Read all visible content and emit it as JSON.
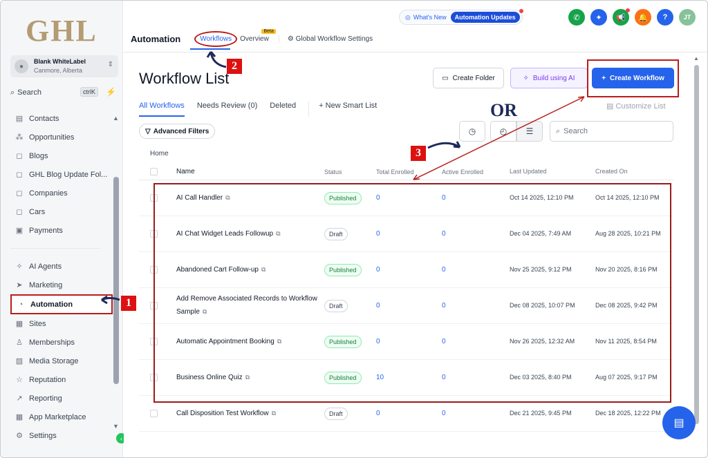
{
  "sidebar": {
    "logo": "GHL",
    "account": {
      "name": "Blank WhiteLabel",
      "location": "Canmore, Alberta"
    },
    "search": {
      "label": "Search",
      "shortcut": "ctrlK"
    },
    "items": [
      {
        "label": "Contacts",
        "icon": "contacts-icon",
        "glyph": "▤"
      },
      {
        "label": "Opportunities",
        "icon": "opportunities-icon",
        "glyph": "⁂"
      },
      {
        "label": "Blogs",
        "icon": "blogs-icon",
        "glyph": "◻"
      },
      {
        "label": "GHL Blog Update Fol...",
        "icon": "folder-icon",
        "glyph": "◻"
      },
      {
        "label": "Companies",
        "icon": "companies-icon",
        "glyph": "◻"
      },
      {
        "label": "Cars",
        "icon": "cars-icon",
        "glyph": "◻"
      },
      {
        "label": "Payments",
        "icon": "payments-icon",
        "glyph": "▣"
      }
    ],
    "items2": [
      {
        "label": "AI Agents",
        "icon": "ai-agents-icon",
        "glyph": "✧"
      },
      {
        "label": "Marketing",
        "icon": "marketing-icon",
        "glyph": "➤"
      },
      {
        "label": "Automation",
        "icon": "automation-icon",
        "glyph": "◔",
        "active": true
      },
      {
        "label": "Sites",
        "icon": "sites-icon",
        "glyph": "▦"
      },
      {
        "label": "Memberships",
        "icon": "memberships-icon",
        "glyph": "♙"
      },
      {
        "label": "Media Storage",
        "icon": "media-storage-icon",
        "glyph": "▨"
      },
      {
        "label": "Reputation",
        "icon": "reputation-icon",
        "glyph": "☆"
      },
      {
        "label": "Reporting",
        "icon": "reporting-icon",
        "glyph": "↗"
      },
      {
        "label": "App Marketplace",
        "icon": "app-marketplace-icon",
        "glyph": "▦"
      },
      {
        "label": "Settings",
        "icon": "settings-icon",
        "glyph": "⚙"
      }
    ]
  },
  "header": {
    "whats_new": "What's New",
    "automation_updates": "Automation Updates",
    "page_section": "Automation",
    "tabs": {
      "workflows": "Workflows",
      "overview": "Overview",
      "beta": "Beta",
      "global": "Global Workflow Settings"
    },
    "avatar_initials": "JT",
    "colors": {
      "phone": "#16a34a",
      "sparkle": "#2563eb",
      "announce": "#16a34a",
      "bell": "#f97316",
      "help": "#2563eb",
      "avatar": "#86c29a"
    }
  },
  "main": {
    "title": "Workflow List",
    "buttons": {
      "create_folder": "Create Folder",
      "build_ai": "Build using AI",
      "create_workflow": "Create Workflow"
    },
    "filter_tabs": {
      "all": "All Workflows",
      "review": "Needs Review (0)",
      "deleted": "Deleted",
      "smart": "New Smart List"
    },
    "customize": "Customize List",
    "advanced_filters": "Advanced Filters",
    "search_placeholder": "Search",
    "breadcrumb": "Home",
    "or_label": "OR",
    "columns": {
      "name": "Name",
      "status": "Status",
      "total": "Total Enrolled",
      "active": "Active Enrolled",
      "updated": "Last Updated",
      "created": "Created On"
    },
    "rows": [
      {
        "name": "AI Call Handler",
        "status": "Published",
        "total": "0",
        "active": "0",
        "updated": "Oct 14 2025, 12:10 PM",
        "created": "Oct 14 2025, 12:10 PM"
      },
      {
        "name": "AI Chat Widget Leads Followup",
        "status": "Draft",
        "total": "0",
        "active": "0",
        "updated": "Dec 04 2025, 7:49 AM",
        "created": "Aug 28 2025, 10:21 PM"
      },
      {
        "name": "Abandoned Cart Follow-up",
        "status": "Published",
        "total": "0",
        "active": "0",
        "updated": "Nov 25 2025, 9:12 PM",
        "created": "Nov 20 2025, 8:16 PM"
      },
      {
        "name": "Add Remove Associated Records to Workflow Sample",
        "status": "Draft",
        "total": "0",
        "active": "0",
        "updated": "Dec 08 2025, 10:07 PM",
        "created": "Dec 08 2025, 9:42 PM"
      },
      {
        "name": "Automatic Appointment Booking",
        "status": "Published",
        "total": "0",
        "active": "0",
        "updated": "Nov 26 2025, 12:32 AM",
        "created": "Nov 11 2025, 8:54 PM"
      },
      {
        "name": "Business Online Quiz",
        "status": "Published",
        "total": "10",
        "active": "0",
        "updated": "Dec 03 2025, 8:40 PM",
        "created": "Aug 07 2025, 9:17 PM"
      },
      {
        "name": "Call Disposition Test Workflow",
        "status": "Draft",
        "total": "0",
        "active": "0",
        "updated": "Dec 21 2025, 9:45 PM",
        "created": "Dec 18 2025, 12:22 PM"
      }
    ]
  },
  "annotations": {
    "m1": "1",
    "m2": "2",
    "m3": "3"
  }
}
